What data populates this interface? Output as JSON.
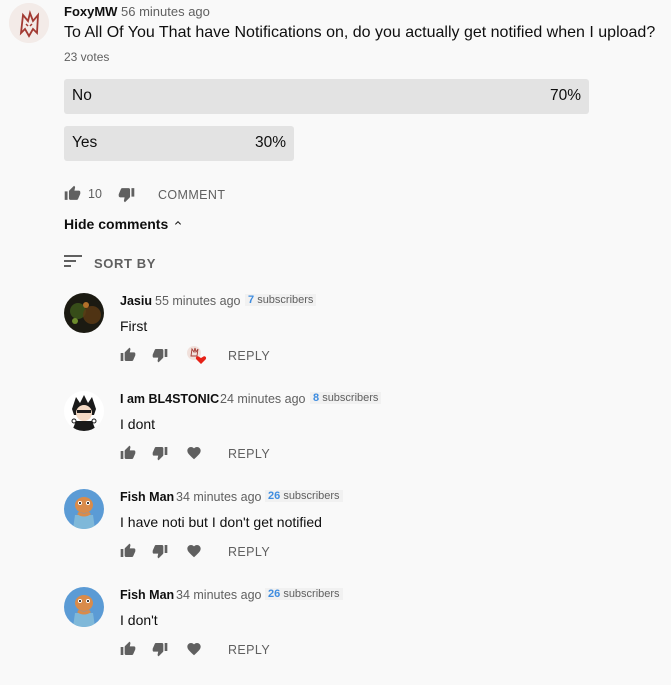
{
  "post": {
    "author": "FoxyMW",
    "time": "56 minutes ago",
    "question": "To All Of You That have Notifications on, do you actually get notified when I upload?",
    "votes": "23 votes",
    "options": [
      {
        "label": "No",
        "percent_text": "70%",
        "percent": 70
      },
      {
        "label": "Yes",
        "percent_text": "30%",
        "percent": 30
      }
    ],
    "likes": "10",
    "comment_label": "COMMENT",
    "hide_comments_label": "Hide comments",
    "sort_by_label": "SORT BY"
  },
  "comments": [
    {
      "name": "Jasiu",
      "time": "55 minutes ago",
      "subs_num": "7",
      "subs_label": "subscribers",
      "text": "First",
      "reply_label": "REPLY",
      "hearted": true
    },
    {
      "name": "I am BL4STONIC",
      "time": "24 minutes ago",
      "subs_num": "8",
      "subs_label": "subscribers",
      "text": "I dont",
      "reply_label": "REPLY",
      "hearted": false
    },
    {
      "name": "Fish Man",
      "time": "34 minutes ago",
      "subs_num": "26",
      "subs_label": "subscribers",
      "text": "I have noti but I don't get notified",
      "reply_label": "REPLY",
      "hearted": false
    },
    {
      "name": "Fish Man",
      "time": "34 minutes ago",
      "subs_num": "26",
      "subs_label": "subscribers",
      "text": "I don't",
      "reply_label": "REPLY",
      "hearted": false
    }
  ],
  "colors": {
    "accent_link": "#3f8de0",
    "heart": "#e62117",
    "poll_bar": "#e3e3e3"
  }
}
